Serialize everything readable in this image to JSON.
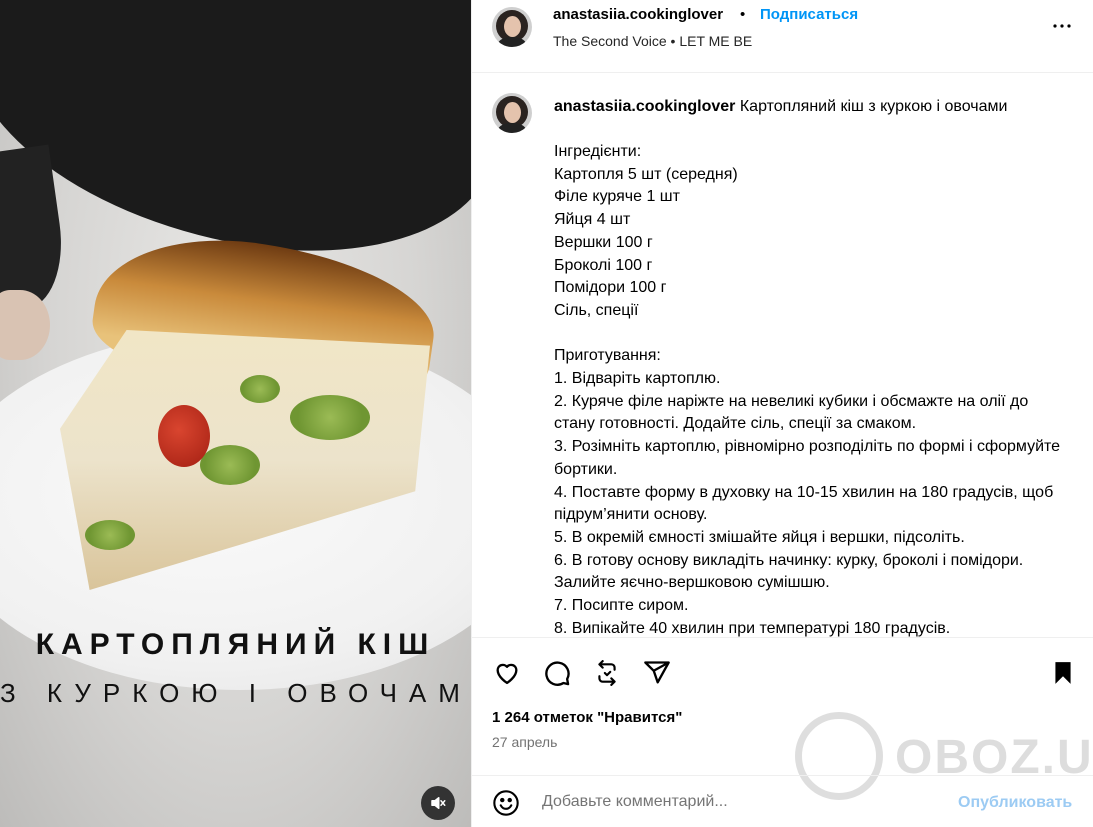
{
  "media": {
    "overlay_title": "КАРТОПЛЯНИЙ КІШ",
    "overlay_subtitle": "З КУРКОЮ І ОВОЧАМИ"
  },
  "header": {
    "username": "anastasiia.cookinglover",
    "separator": "•",
    "follow_label": "Подписаться",
    "audio": "The Second Voice • LET ME BE"
  },
  "caption": {
    "username": "anastasiia.cookinglover",
    "title": "Картопляний кіш з куркою і овочами",
    "body": "Інгредієнти:\nКартопля 5 шт (середня)\nФіле куряче 1 шт\nЯйця 4 шт\nВершки 100 г\nБроколі 100 г\nПомідори 100 г\nСіль, спеції\n\nПриготування:\n1. Відваріть картоплю.\n2. Куряче філе наріжте на невеликі кубики і обсмажте на олії до стану готовності. Додайте сіль, спеції за смаком.\n3. Розімніть картоплю, рівномірно розподіліть по формі і сформуйте бортики.\n4. Поставте форму в духовку на 10-15 хвилин на 180 градусів, щоб підрум’янити основу.\n5. В окремій ємності змішайте яйця і вершки, підсоліть.\n6. В готову основу викладіть начинку: курку, броколі і помідори. Залийте яєчно-вершковою сумішшю.\n7. Посипте сиром.\n8. Випікайте 40 хвилин при температурі 180 градусів."
  },
  "stats": {
    "likes": "1 264 отметок \"Нравится\"",
    "date": "27 апрель"
  },
  "comment": {
    "placeholder": "Добавьте комментарий...",
    "publish_label": "Опубликовать"
  },
  "watermark": "OBOZ.UA",
  "colors": {
    "accent": "#0095f6",
    "publish_disabled": "#9ccbf3",
    "secondary_text": "#737373",
    "divider": "#efefef"
  },
  "icons": [
    "heart-icon",
    "comment-icon",
    "repost-icon",
    "share-icon",
    "bookmark-icon",
    "more-icon",
    "emoji-icon",
    "mute-icon"
  ]
}
